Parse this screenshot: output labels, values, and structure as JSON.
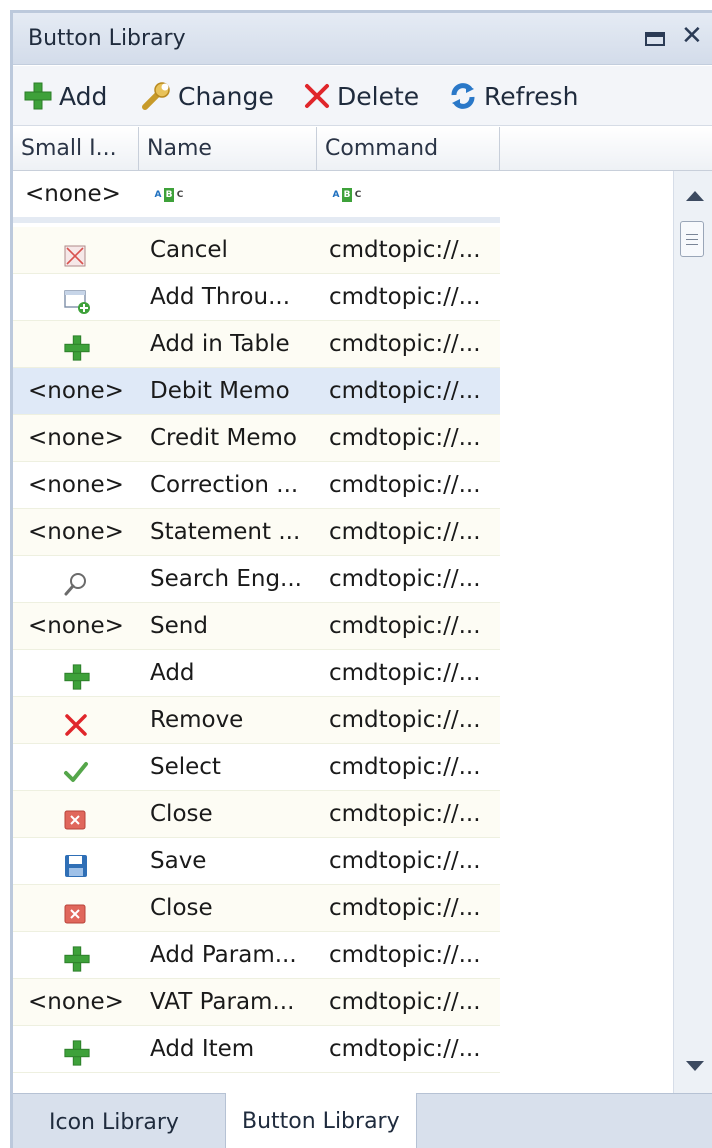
{
  "panel": {
    "title": "Button Library"
  },
  "toolbar": {
    "add_label": "Add",
    "change_label": "Change",
    "delete_label": "Delete",
    "refresh_label": "Refresh"
  },
  "columns": {
    "small_image": "Small I...",
    "name": "Name",
    "command": "Command"
  },
  "filter_row": {
    "image_value": "<none>"
  },
  "rows": [
    {
      "icon": "cancel-icon",
      "image_text": "",
      "name": "Cancel",
      "command": "cmdtopic://..."
    },
    {
      "icon": "add-through-icon",
      "image_text": "",
      "name": "Add Throu...",
      "command": "cmdtopic://..."
    },
    {
      "icon": "plus-icon",
      "image_text": "",
      "name": "Add in Table",
      "command": "cmdtopic://..."
    },
    {
      "icon": "",
      "image_text": "<none>",
      "name": "Debit Memo",
      "command": "cmdtopic://..."
    },
    {
      "icon": "",
      "image_text": "<none>",
      "name": "Credit Memo",
      "command": "cmdtopic://..."
    },
    {
      "icon": "",
      "image_text": "<none>",
      "name": "Correction ...",
      "command": "cmdtopic://..."
    },
    {
      "icon": "",
      "image_text": "<none>",
      "name": "Statement ...",
      "command": "cmdtopic://..."
    },
    {
      "icon": "magnifier-icon",
      "image_text": "",
      "name": "Search Eng...",
      "command": "cmdtopic://..."
    },
    {
      "icon": "",
      "image_text": "<none>",
      "name": "Send",
      "command": "cmdtopic://..."
    },
    {
      "icon": "plus-icon",
      "image_text": "",
      "name": "Add",
      "command": "cmdtopic://..."
    },
    {
      "icon": "red-x-icon",
      "image_text": "",
      "name": "Remove",
      "command": "cmdtopic://..."
    },
    {
      "icon": "checkmark-icon",
      "image_text": "",
      "name": "Select",
      "command": "cmdtopic://..."
    },
    {
      "icon": "close-box-icon",
      "image_text": "",
      "name": "Close",
      "command": "cmdtopic://..."
    },
    {
      "icon": "floppy-disk-icon",
      "image_text": "",
      "name": "Save",
      "command": "cmdtopic://..."
    },
    {
      "icon": "close-box-icon",
      "image_text": "",
      "name": "Close",
      "command": "cmdtopic://..."
    },
    {
      "icon": "plus-icon",
      "image_text": "",
      "name": "Add Param...",
      "command": "cmdtopic://..."
    },
    {
      "icon": "",
      "image_text": "<none>",
      "name": "VAT Param...",
      "command": "cmdtopic://..."
    },
    {
      "icon": "plus-icon",
      "image_text": "",
      "name": "Add Item",
      "command": "cmdtopic://..."
    }
  ],
  "selected_row_index": 3,
  "tabs": [
    {
      "label": "Icon Library",
      "active": false
    },
    {
      "label": "Button Library",
      "active": true
    }
  ],
  "colors": {
    "accent_green": "#3ea13a",
    "delete_red": "#e0262b",
    "selection": "#dfe9f7",
    "panel_border": "#bcc9dc"
  }
}
